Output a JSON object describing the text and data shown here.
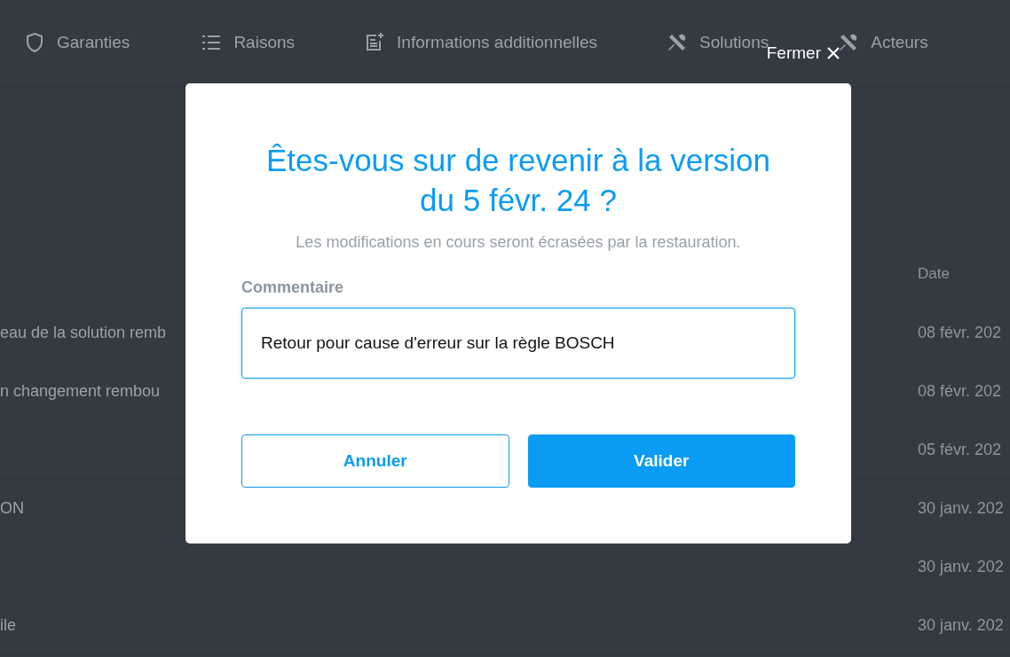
{
  "tabs": [
    {
      "label": "Garanties",
      "kind": "shield"
    },
    {
      "label": "Raisons",
      "kind": "list"
    },
    {
      "label": "Informations additionnelles",
      "kind": "note"
    },
    {
      "label": "Solutions",
      "kind": "tools"
    },
    {
      "label": "Acteurs",
      "kind": "tools"
    }
  ],
  "table": {
    "columns": [
      {
        "label": "Date"
      }
    ],
    "rows": [
      {
        "column_1": "eau de la solution remb",
        "date": "08 févr. 202"
      },
      {
        "column_1": "n changement rembou",
        "date": "08 févr. 202"
      },
      {
        "date": "05 févr. 202"
      },
      {
        "column_1": "ON",
        "date": "30 janv. 202"
      },
      {
        "date": "30 janv. 202"
      },
      {
        "column_1": "ile",
        "date": "30 janv. 202"
      }
    ]
  },
  "dialog": {
    "close_label": "Fermer",
    "title": "Êtes-vous sur de revenir à la version du 5 févr. 24 ?",
    "subtitle": "Les modifications en cours seront écrasées par la restauration.",
    "comment_label": "Commentaire",
    "comment_value": "Retour pour cause d'erreur sur la règle BOSCH",
    "buttons": [
      {
        "label": "Annuler",
        "kind": "secondary"
      },
      {
        "label": "Valider",
        "kind": "primary"
      }
    ]
  }
}
